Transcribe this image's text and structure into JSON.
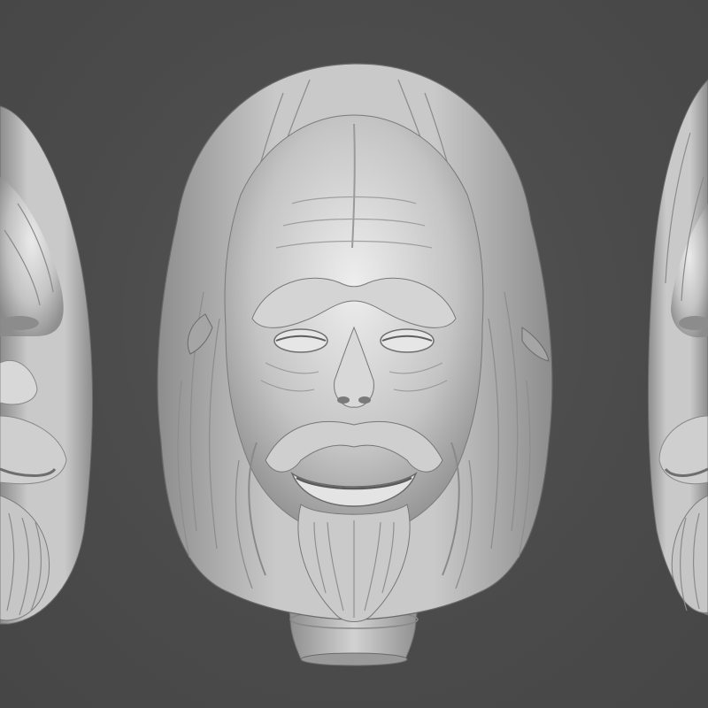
{
  "scene": {
    "description_free": true,
    "background_color": "#4a4a4a",
    "model_color": "#bdbdbd",
    "shadow_color": "#6e6e6e",
    "highlight_color": "#e4e4e4",
    "views": [
      {
        "name": "left-three-quarter-view"
      },
      {
        "name": "front-view"
      },
      {
        "name": "right-three-quarter-view"
      }
    ]
  }
}
